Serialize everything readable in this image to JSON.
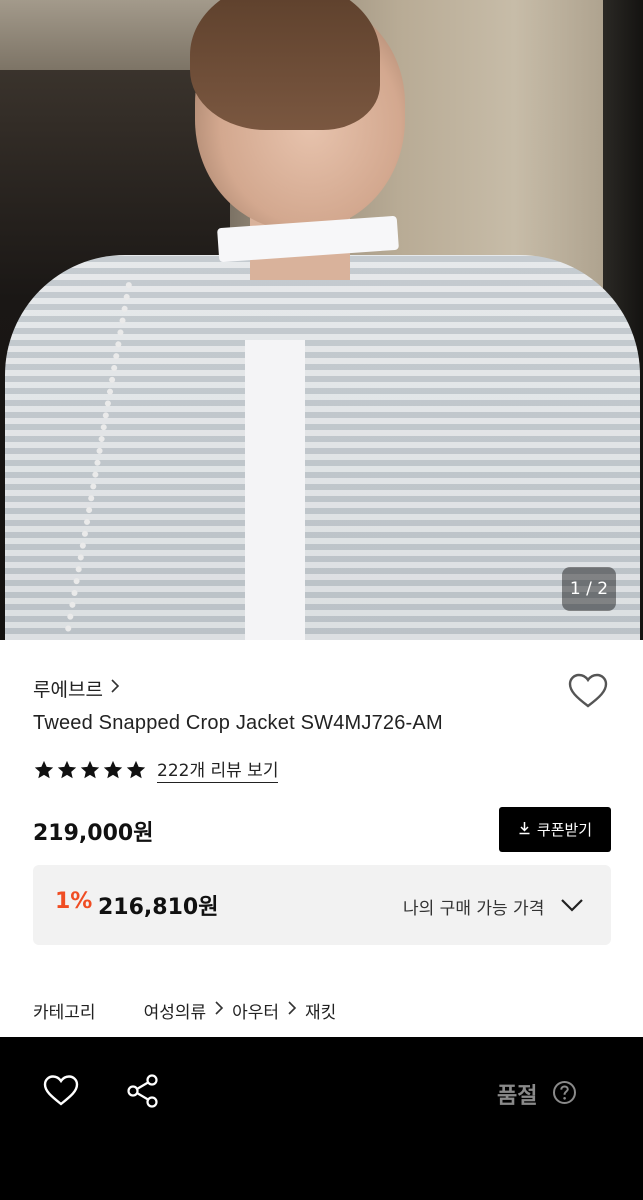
{
  "hero": {
    "image_description_icon": "product-photo",
    "counter": "1 / 2"
  },
  "product": {
    "brand": "루에브르",
    "name": "Tweed Snapped Crop Jacket SW4MJ726-AM",
    "rating_stars": 5,
    "review_link": "222개 리뷰 보기",
    "price": "219,000원",
    "coupon_button": "쿠폰받기"
  },
  "my_price": {
    "discount": "1%",
    "price": "216,810원",
    "label": "나의 구매 가능 가격"
  },
  "category": {
    "title": "카테고리",
    "path": [
      "여성의류",
      "아우터",
      "재킷"
    ]
  },
  "bottom_bar": {
    "status": "품절"
  },
  "colors": {
    "accent": "#f04d23",
    "bottom_bar_bg": "#000000",
    "price_box_bg": "#f2f2f2"
  }
}
